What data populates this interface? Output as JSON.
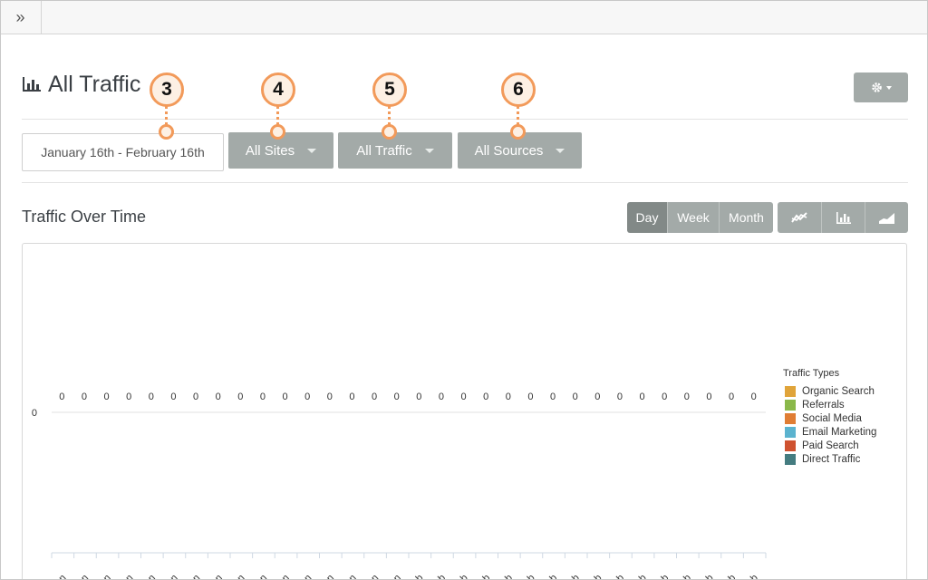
{
  "page": {
    "title": "All Traffic",
    "title_icon": "bar-chart-icon",
    "settings_icon": "gear-icon"
  },
  "filters": {
    "date_range": "January 16th - February 16th",
    "sites": "All Sites",
    "traffic": "All Traffic",
    "sources": "All Sources"
  },
  "section": {
    "title": "Traffic Over Time",
    "period_options": [
      "Day",
      "Week",
      "Month"
    ],
    "selected_period": "Day",
    "chart_type_icons": [
      "line-chart-icon",
      "bar-chart-icon",
      "area-chart-icon"
    ]
  },
  "legend": {
    "title": "Traffic Types",
    "items": [
      {
        "label": "Organic Search",
        "color": "#e0a43a"
      },
      {
        "label": "Referrals",
        "color": "#8ab84a"
      },
      {
        "label": "Social Media",
        "color": "#e07d34"
      },
      {
        "label": "Email Marketing",
        "color": "#5bb3cf"
      },
      {
        "label": "Paid Search",
        "color": "#cf5230"
      },
      {
        "label": "Direct Traffic",
        "color": "#447c80"
      }
    ]
  },
  "callouts": [
    "3",
    "4",
    "5",
    "6"
  ],
  "chart_data": {
    "type": "bar",
    "categories": [
      "Jan",
      "Jan",
      "Jan",
      "Jan",
      "Jan",
      "Jan",
      "Jan",
      "Jan",
      "Jan",
      "Jan",
      "Jan",
      "Jan",
      "Jan",
      "Jan",
      "Jan",
      "Jan",
      "Feb",
      "Feb",
      "Feb",
      "Feb",
      "Feb",
      "Feb",
      "Feb",
      "Feb",
      "Feb",
      "Feb",
      "Feb",
      "Feb",
      "Feb",
      "Feb",
      "Feb",
      "Feb"
    ],
    "values": [
      0,
      0,
      0,
      0,
      0,
      0,
      0,
      0,
      0,
      0,
      0,
      0,
      0,
      0,
      0,
      0,
      0,
      0,
      0,
      0,
      0,
      0,
      0,
      0,
      0,
      0,
      0,
      0,
      0,
      0,
      0,
      0
    ],
    "data_labels": [
      "0",
      "0",
      "0",
      "0",
      "0",
      "0",
      "0",
      "0",
      "0",
      "0",
      "0",
      "0",
      "0",
      "0",
      "0",
      "0",
      "0",
      "0",
      "0",
      "0",
      "0",
      "0",
      "0",
      "0",
      "0",
      "0",
      "0",
      "0",
      "0",
      "0",
      "0",
      "0"
    ],
    "y_ticks": [
      "0"
    ],
    "legend_title": "Traffic Types",
    "legend_placement": "right"
  }
}
